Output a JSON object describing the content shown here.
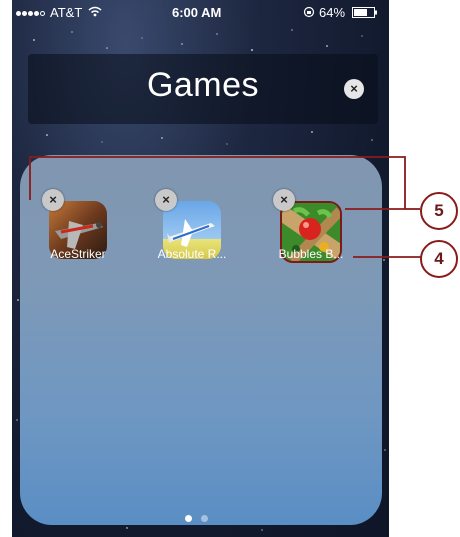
{
  "status_bar": {
    "carrier": "AT&T",
    "time": "6:00 AM",
    "battery": "64%"
  },
  "folder": {
    "title": "Games",
    "clear_symbol": "×",
    "apps": [
      {
        "label": "AceStriker",
        "delete_symbol": "×",
        "icon": "fighter-plane-icon"
      },
      {
        "label": "Absolute R...",
        "delete_symbol": "×",
        "icon": "small-plane-icon"
      },
      {
        "label": "Bubbles B...",
        "delete_symbol": "×",
        "icon": "bubbles-icon"
      }
    ],
    "pages": {
      "count": 2,
      "current": 1
    }
  },
  "callouts": [
    "5",
    "4"
  ],
  "colors": {
    "callout": "#8b1a1a",
    "delete_badge": "#c9c9c9"
  }
}
